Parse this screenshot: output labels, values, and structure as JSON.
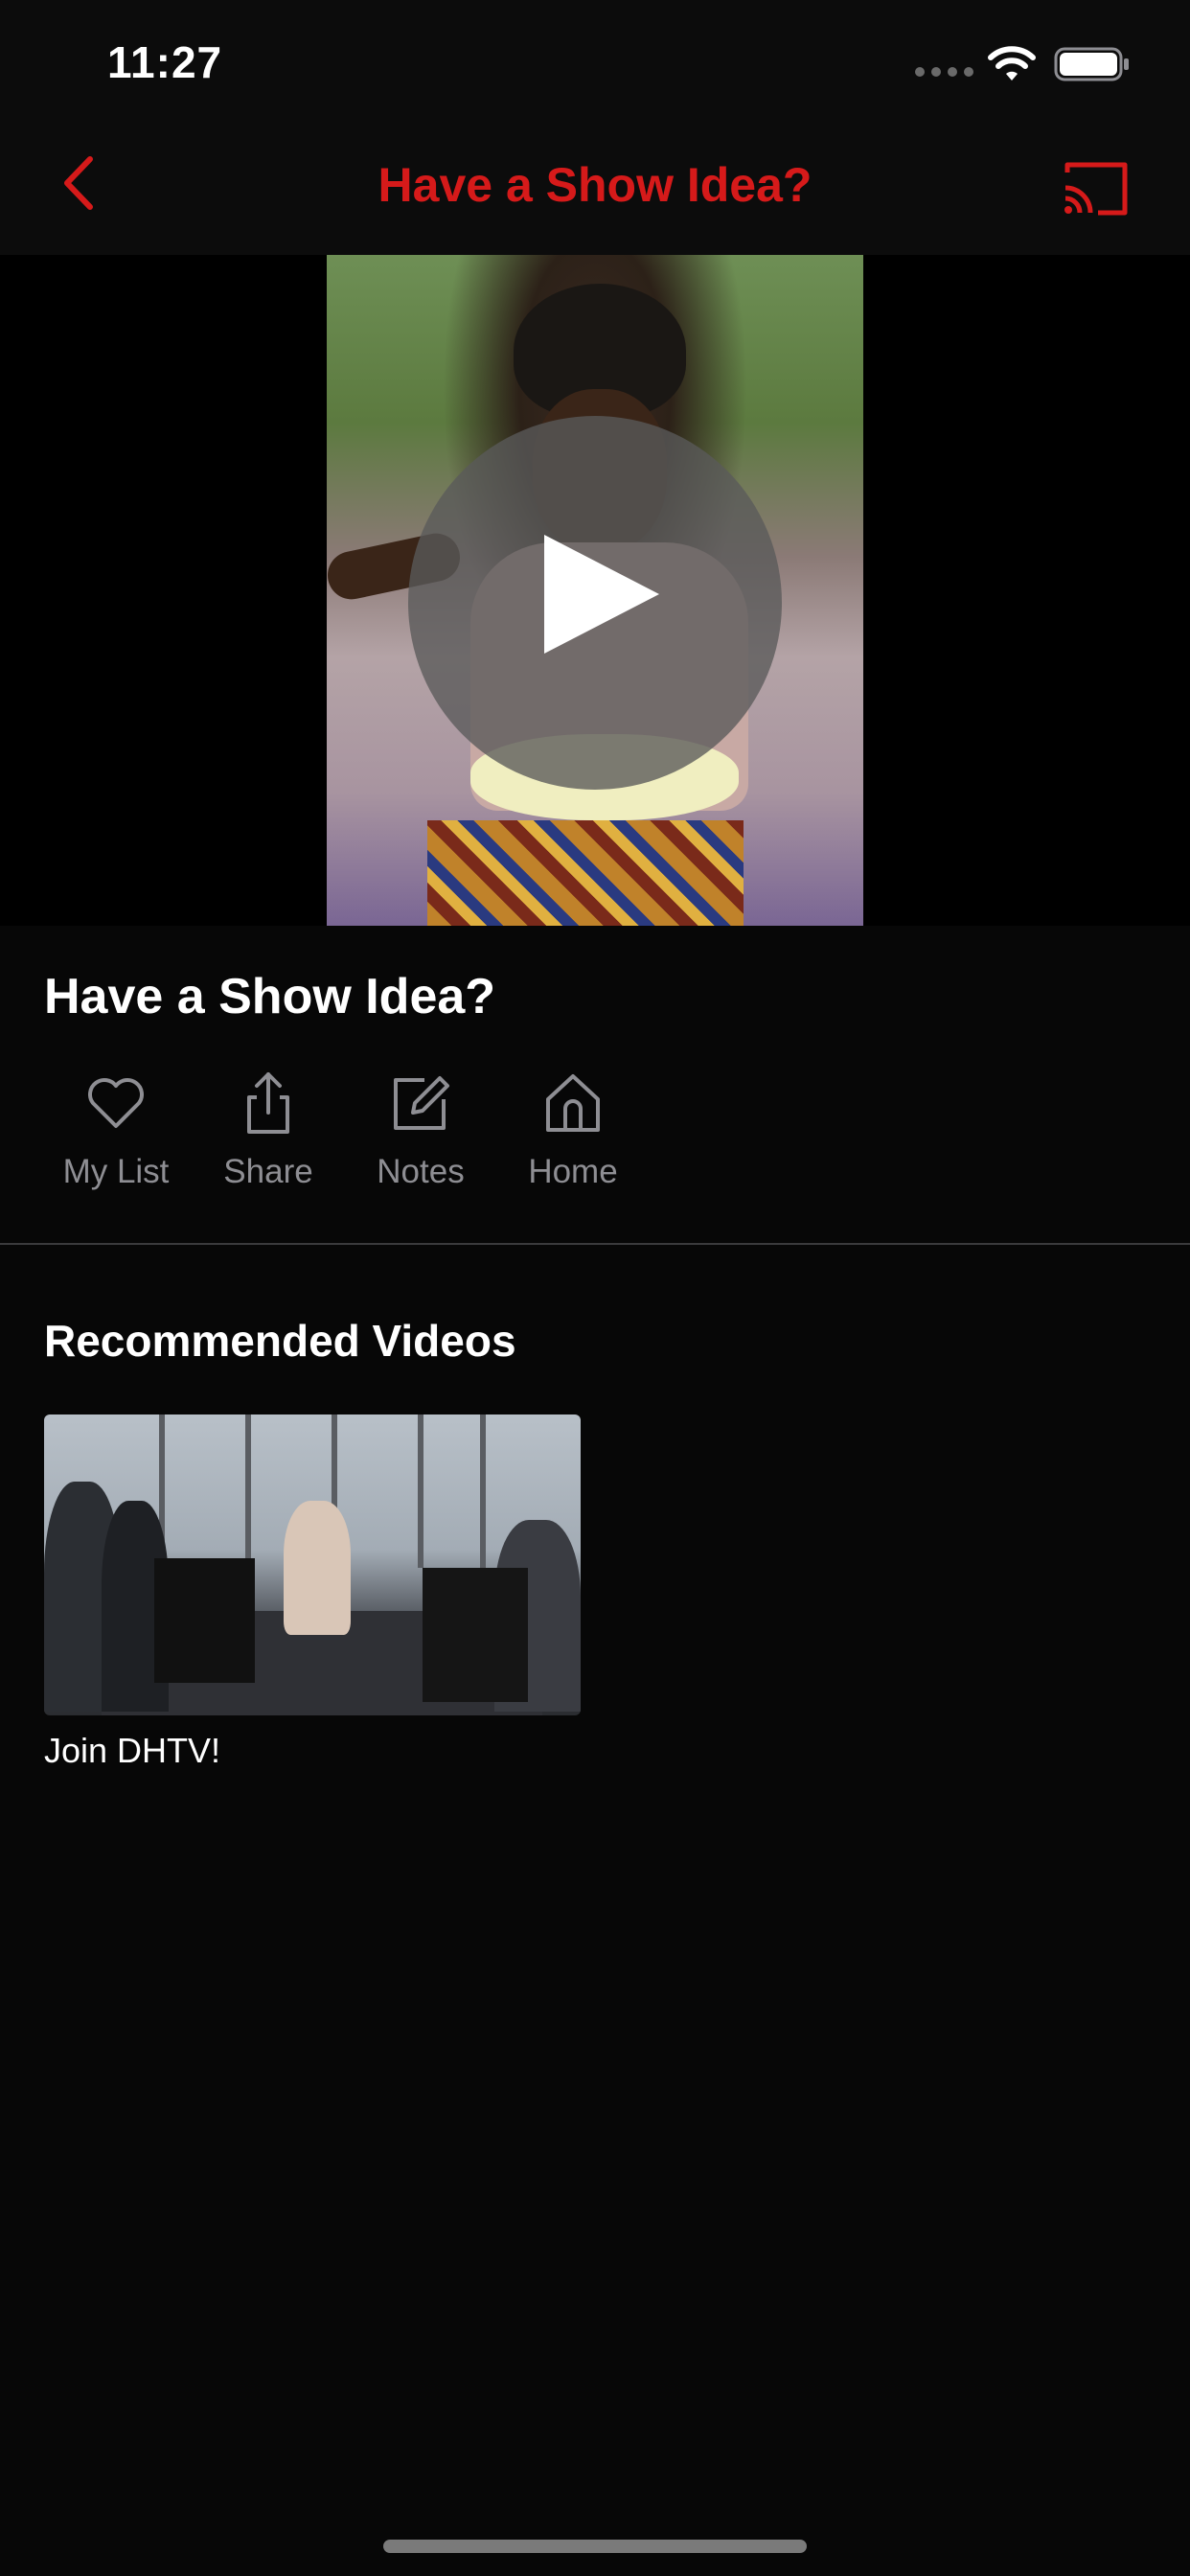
{
  "status_bar": {
    "time": "11:27",
    "icons": [
      "signal-icon",
      "wifi-icon",
      "battery-icon"
    ]
  },
  "nav": {
    "title": "Have a Show Idea?",
    "back_icon": "chevron-left-icon",
    "cast_icon": "cast-icon",
    "accent_color": "#d61a1a"
  },
  "video": {
    "play_icon": "play-icon"
  },
  "detail": {
    "title": "Have a Show Idea?",
    "actions": [
      {
        "label": "My List",
        "icon": "heart-icon"
      },
      {
        "label": "Share",
        "icon": "share-icon"
      },
      {
        "label": "Notes",
        "icon": "edit-icon"
      },
      {
        "label": "Home",
        "icon": "home-icon"
      }
    ]
  },
  "recommended": {
    "title": "Recommended Videos",
    "items": [
      {
        "label": "Join DHTV!"
      }
    ]
  }
}
